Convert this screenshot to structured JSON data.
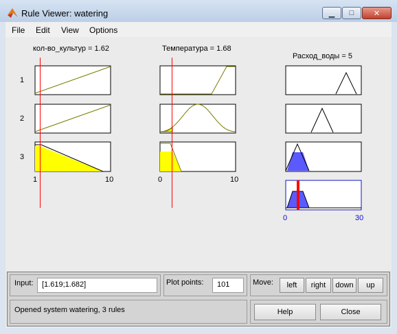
{
  "window": {
    "title": "Rule Viewer: watering"
  },
  "menu": [
    "File",
    "Edit",
    "View",
    "Options"
  ],
  "inputs": [
    {
      "label": "кол-во_культур = 1.62",
      "range_min": "1",
      "range_max": "10",
      "value": 1.62,
      "min": 1,
      "max": 10
    },
    {
      "label": "Температура = 1.68",
      "range_min": "0",
      "range_max": "10",
      "value": 1.68,
      "min": 0,
      "max": 10
    }
  ],
  "output": {
    "label": "Расход_воды = 5",
    "range_min": "0",
    "range_max": "30",
    "value": 5,
    "min": 0,
    "max": 30
  },
  "rules": [
    "1",
    "2",
    "3"
  ],
  "controls": {
    "input_label": "Input:",
    "input_value": "[1.619;1.682]",
    "plot_points_label": "Plot points:",
    "plot_points_value": "101",
    "move_label": "Move:",
    "move_buttons": [
      "left",
      "right",
      "down",
      "up"
    ],
    "status": "Opened system watering, 3 rules",
    "help_label": "Help",
    "close_label": "Close"
  },
  "colors": {
    "fill_yellow": "#ffff00",
    "fill_blue": "#5a5aff",
    "line_olive": "#7a7a00",
    "marker_red": "#ff0000"
  }
}
